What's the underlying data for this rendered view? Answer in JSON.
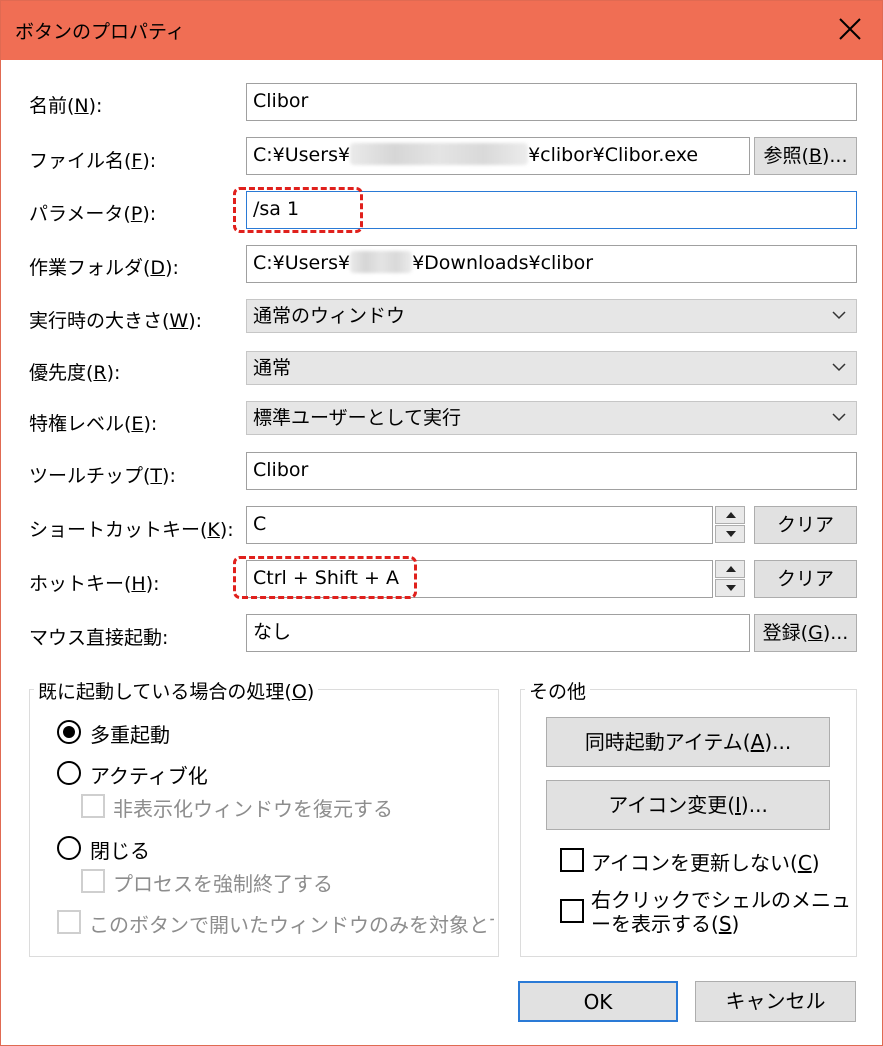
{
  "window": {
    "title": "ボタンのプロパティ"
  },
  "fields": {
    "name": {
      "label_pre": "名前(",
      "key": "N",
      "label_post": "):",
      "value": "Clibor"
    },
    "file": {
      "label_pre": "ファイル名(",
      "key": "F",
      "label_post": "):",
      "value_pre": "C:¥Users¥",
      "value_post": "¥clibor¥Clibor.exe",
      "browse_pre": "参照(",
      "browse_key": "B",
      "browse_post": ")..."
    },
    "params": {
      "label_pre": "パラメータ(",
      "key": "P",
      "label_post": "):",
      "value": "/sa 1"
    },
    "workdir": {
      "label_pre": "作業フォルダ(",
      "key": "D",
      "label_post": "):",
      "value_pre": "C:¥Users¥",
      "value_post": "¥Downloads¥clibor"
    },
    "runsize": {
      "label_pre": "実行時の大きさ(",
      "key": "W",
      "label_post": "):",
      "value": "通常のウィンドウ"
    },
    "priority": {
      "label_pre": "優先度(",
      "key": "R",
      "label_post": "):",
      "value": "通常"
    },
    "privilege": {
      "label_pre": "特権レベル(",
      "key": "E",
      "label_post": "):",
      "value": "標準ユーザーとして実行"
    },
    "tooltip": {
      "label_pre": "ツールチップ(",
      "key": "T",
      "label_post": "):",
      "value": "Clibor"
    },
    "shortcut": {
      "label_pre": "ショートカットキー(",
      "key": "K",
      "label_post": "):",
      "value": "C",
      "clear": "クリア"
    },
    "hotkey": {
      "label_pre": "ホットキー(",
      "key": "H",
      "label_post": "):",
      "value": "Ctrl + Shift + A",
      "clear": "クリア"
    },
    "mouse": {
      "label": "マウス直接起動:",
      "value": "なし",
      "register_pre": "登録(",
      "register_key": "G",
      "register_post": ")..."
    }
  },
  "running_group": {
    "title_pre": "既に起動している場合の処理(",
    "title_key": "O",
    "title_post": ")",
    "options": {
      "multi": {
        "label": "多重起動",
        "selected": true
      },
      "activate": {
        "label": "アクティブ化",
        "selected": false
      },
      "restore_hidden": {
        "label": "非表示化ウィンドウを復元する",
        "checked": false,
        "enabled": false
      },
      "close": {
        "label": "閉じる",
        "selected": false
      },
      "force_kill": {
        "label": "プロセスを強制終了する",
        "checked": false,
        "enabled": false
      },
      "only_this": {
        "label": "このボタンで開いたウィンドウのみを対象とす",
        "checked": false,
        "enabled": false
      }
    }
  },
  "other_group": {
    "title": "その他",
    "simul_pre": "同時起動アイテム(",
    "simul_key": "A",
    "simul_post": ")...",
    "icon_pre": "アイコン変更(",
    "icon_key": "I",
    "icon_post": ")...",
    "no_update_pre": "アイコンを更新しない(",
    "no_update_key": "C",
    "no_update_post": ")",
    "shell_line1": "右クリックでシェルのメニュ",
    "shell_line2_pre": "ーを表示する(",
    "shell_key": "S",
    "shell_line2_post": ")"
  },
  "footer": {
    "ok": "OK",
    "cancel": "キャンセル"
  },
  "colors": {
    "titlebar": "#f06e54",
    "highlight": "#e0201c",
    "focus_border": "#2a7ad6"
  }
}
